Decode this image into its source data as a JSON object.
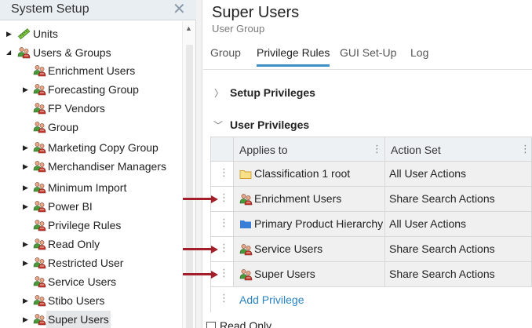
{
  "left_panel": {
    "title": "System Setup",
    "close_icon": "close-icon",
    "tree": [
      {
        "label": "Units",
        "icon": "unit-ruler-icon",
        "expandable": true,
        "expanded": false,
        "selected": false
      },
      {
        "label": "Users & Groups",
        "icon": "users-icon",
        "expandable": true,
        "expanded": true,
        "selected": false
      },
      {
        "label": "Enrichment Users",
        "icon": "users-icon",
        "expandable": false,
        "expanded": false,
        "selected": false
      },
      {
        "label": "Forecasting Group",
        "icon": "users-icon",
        "expandable": true,
        "expanded": false,
        "selected": false
      },
      {
        "label": "FP Vendors",
        "icon": "users-icon",
        "expandable": false,
        "expanded": false,
        "selected": false
      },
      {
        "label": "Group",
        "icon": "users-icon",
        "expandable": false,
        "expanded": false,
        "selected": false
      },
      {
        "label": "Marketing Copy Group",
        "icon": "users-icon",
        "expandable": true,
        "expanded": false,
        "selected": false
      },
      {
        "label": "Merchandiser Managers",
        "icon": "users-icon",
        "expandable": true,
        "expanded": false,
        "selected": false
      },
      {
        "label": "Minimum Import",
        "icon": "users-icon",
        "expandable": true,
        "expanded": false,
        "selected": false
      },
      {
        "label": "Power BI",
        "icon": "users-icon",
        "expandable": true,
        "expanded": false,
        "selected": false
      },
      {
        "label": "Privilege Rules",
        "icon": "users-icon",
        "expandable": false,
        "expanded": false,
        "selected": false
      },
      {
        "label": "Read Only",
        "icon": "users-icon",
        "expandable": true,
        "expanded": false,
        "selected": false
      },
      {
        "label": "Restricted User",
        "icon": "users-icon",
        "expandable": true,
        "expanded": false,
        "selected": false
      },
      {
        "label": "Service Users",
        "icon": "users-icon",
        "expandable": false,
        "expanded": false,
        "selected": false
      },
      {
        "label": "Stibo Users",
        "icon": "users-icon",
        "expandable": true,
        "expanded": false,
        "selected": false
      },
      {
        "label": "Super Users",
        "icon": "users-icon",
        "expandable": true,
        "expanded": false,
        "selected": true
      }
    ]
  },
  "main": {
    "title": "Super Users",
    "subtitle": "User Group",
    "tabs": [
      {
        "label": "Group",
        "active": false
      },
      {
        "label": "Privilege Rules",
        "active": true
      },
      {
        "label": "GUI Set-Up",
        "active": false
      },
      {
        "label": "Log",
        "active": false
      }
    ],
    "sections": {
      "setup_privileges": {
        "label": "Setup Privileges",
        "expanded": false
      },
      "user_privileges": {
        "label": "User Privileges",
        "expanded": true
      }
    },
    "table": {
      "columns": [
        "Applies to",
        "Action Set"
      ],
      "rows": [
        {
          "applies_to": "Classification 1 root",
          "action_set": "All User Actions",
          "icon": "classification-folder-icon",
          "highlighted": false
        },
        {
          "applies_to": "Enrichment Users",
          "action_set": "Share Search Actions",
          "icon": "users-icon",
          "highlighted": true
        },
        {
          "applies_to": "Primary Product Hierarchy",
          "action_set": "All User Actions",
          "icon": "product-folder-icon",
          "highlighted": false
        },
        {
          "applies_to": "Service Users",
          "action_set": "Share Search Actions",
          "icon": "users-icon",
          "highlighted": true
        },
        {
          "applies_to": "Super Users",
          "action_set": "Share Search Actions",
          "icon": "users-icon",
          "highlighted": true
        }
      ],
      "add_label": "Add Privilege"
    },
    "read_only_label": "Read Only",
    "read_only_checked": false
  },
  "colors": {
    "accent": "#3d8fc6",
    "link": "#2a83c3",
    "arrow": "#a31f2a",
    "folder_yellow": "#f3c94c",
    "folder_blue": "#3a7fd5",
    "user_icon_green": "#4a9a3a",
    "user_icon_red": "#c0392b"
  }
}
